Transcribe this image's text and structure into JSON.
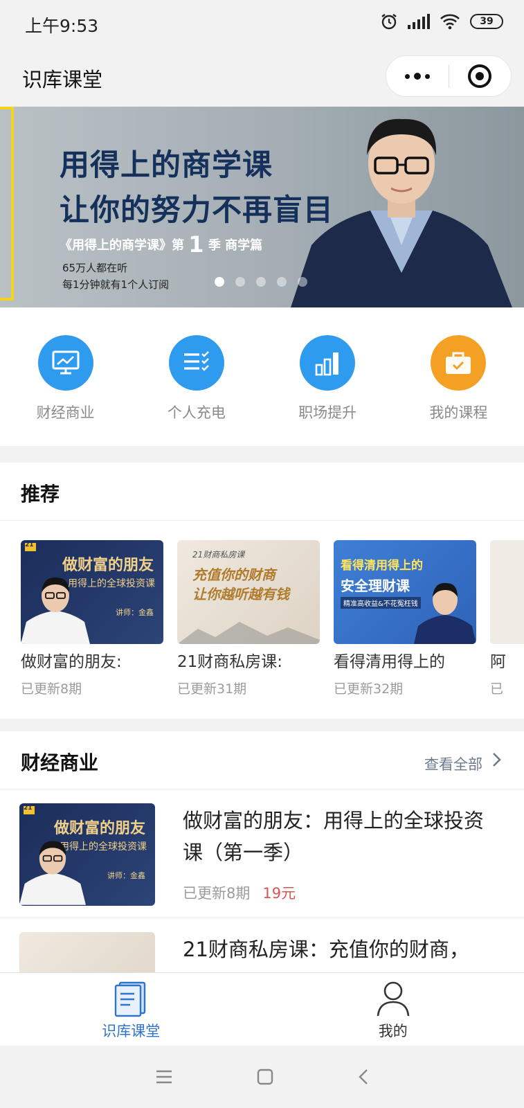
{
  "status_bar": {
    "time": "上午9:53",
    "battery": "39"
  },
  "header": {
    "title": "识库课堂"
  },
  "banner": {
    "headline_1": "用得上的商学课",
    "headline_2": "让你的努力不再盲目",
    "subtitle_prefix": "《用得上的商学课》第",
    "subtitle_num": "1",
    "subtitle_suffix": "季 商学篇",
    "line_1": "65万人都在听",
    "line_2": "每1分钟就有1个人订阅",
    "active_slide": 1,
    "slide_count": 5
  },
  "categories": [
    {
      "label": "财经商业",
      "icon": "monitor-chart-icon",
      "color": "#2f9bee"
    },
    {
      "label": "个人充电",
      "icon": "checklist-icon",
      "color": "#2f9bee"
    },
    {
      "label": "职场提升",
      "icon": "bar-growth-icon",
      "color": "#2f9bee"
    },
    {
      "label": "我的课程",
      "icon": "briefcase-icon",
      "color": "#f4a025"
    }
  ],
  "recommend": {
    "title": "推荐",
    "cards": [
      {
        "name": "做财富的朋友:",
        "updated": "已更新8期",
        "cover_title": "做财富的朋友",
        "cover_sub": "用得上的全球投资课",
        "cover_teacher": "讲师：金鑫",
        "cover_badge": "21"
      },
      {
        "name": "21财商私房课:",
        "updated": "已更新31期",
        "cover_l1": "21财商私房课",
        "cover_l2": "充值你的财商",
        "cover_l3": "让你越听越有钱"
      },
      {
        "name": "看得清用得上的",
        "updated": "已更新32期",
        "cover_l1": "看得清用得上的",
        "cover_l2": "安全理财课",
        "cover_l3": "精准高收益&不花冤枉钱"
      },
      {
        "name": "阿",
        "updated": "已"
      }
    ]
  },
  "finance": {
    "title": "财经商业",
    "more": "查看全部",
    "items": [
      {
        "title": "做财富的朋友：用得上的全球投资课（第一季）",
        "updated": "已更新8期",
        "price": "19元",
        "cover_title": "做财富的朋友",
        "cover_sub": "用得上的全球投资课",
        "cover_teacher": "讲师：金鑫",
        "cover_badge": "21"
      },
      {
        "title": "21财商私房课：充值你的财商，"
      }
    ]
  },
  "tabbar": [
    {
      "label": "识库课堂",
      "active": true,
      "color": "#2f74c9"
    },
    {
      "label": "我的",
      "active": false,
      "color": "#333333"
    }
  ]
}
